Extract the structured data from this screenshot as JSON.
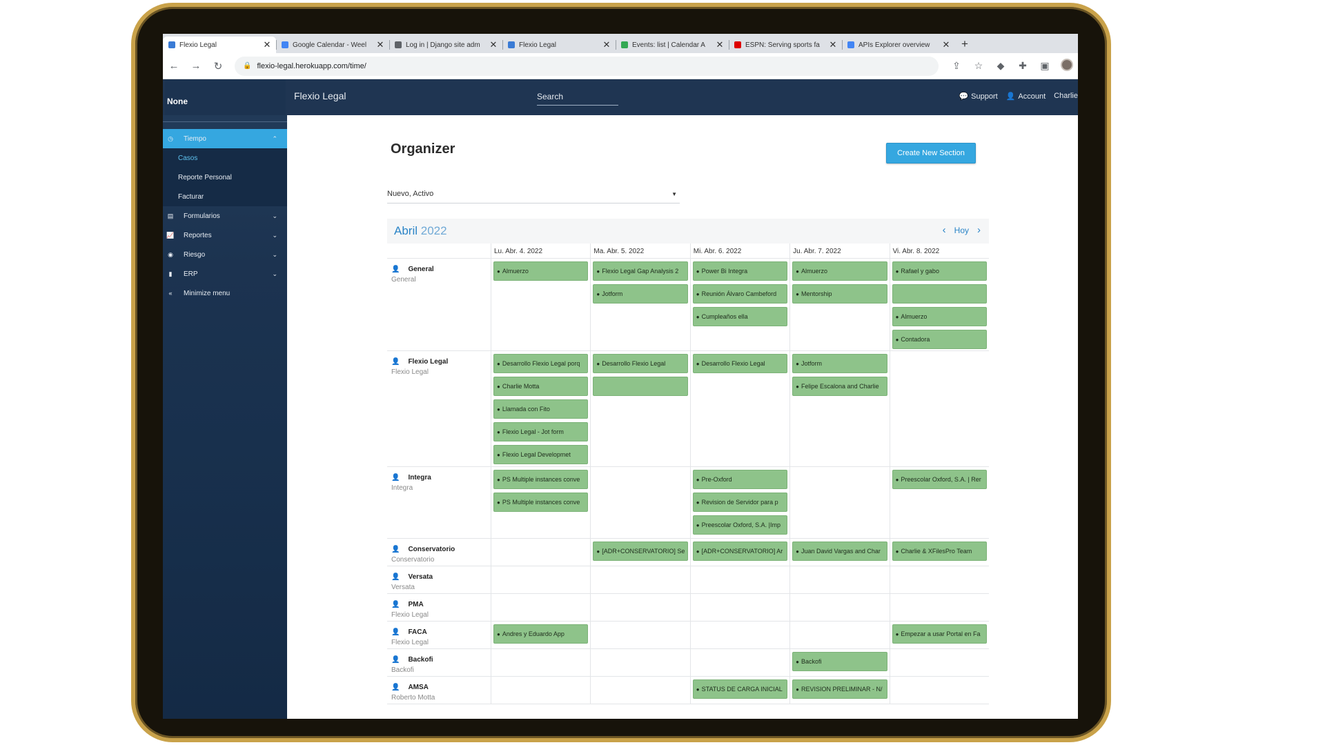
{
  "browser": {
    "tabs": [
      {
        "title": "Flexio Legal",
        "color": "#3a7bd5",
        "active": true
      },
      {
        "title": "Google Calendar - Weel",
        "color": "#4285f4",
        "active": false
      },
      {
        "title": "Log in | Django site adm",
        "color": "#5f6368",
        "active": false
      },
      {
        "title": "Flexio Legal",
        "color": "#3a7bd5",
        "active": false
      },
      {
        "title": "Events: list | Calendar A",
        "color": "#34a853",
        "active": false
      },
      {
        "title": "ESPN: Serving sports fa",
        "color": "#d00",
        "active": false
      },
      {
        "title": "APIs Explorer overview",
        "color": "#4285f4",
        "active": false
      }
    ],
    "new_tab": "+",
    "close": "✕",
    "url": "flexio-legal.herokuapp.com/time/"
  },
  "header": {
    "org": "None",
    "brand": "Flexio Legal",
    "search": "Search",
    "support": "Support",
    "account": "Account",
    "user": "Charlie"
  },
  "sidebar": {
    "tiempo": "Tiempo",
    "sub": [
      "Casos",
      "Reporte Personal",
      "Facturar"
    ],
    "items": [
      "Formularios",
      "Reportes",
      "Riesgo",
      "ERP"
    ],
    "minimize": "Minimize menu"
  },
  "main": {
    "title": "Organizer",
    "create_button": "Create New Section",
    "filter_value": "Nuevo, Activo",
    "month": "Abril",
    "year": "2022",
    "today": "Hoy"
  },
  "calendar": {
    "days": [
      "Lu. Abr. 4. 2022",
      "Ma. Abr. 5. 2022",
      "Mi. Abr. 6. 2022",
      "Ju. Abr. 7. 2022",
      "Vi. Abr. 8. 2022"
    ],
    "rows": [
      {
        "name": "General",
        "sub": "General",
        "height": 134,
        "cells": [
          [
            "Almuerzo"
          ],
          [
            "Flexio Legal Gap Analysis 2",
            "Jotform"
          ],
          [
            "Power Bi Integra",
            "Reunión Álvaro Cambeford",
            "Cumpleaños ella"
          ],
          [
            "Almuerzo",
            "Mentorship"
          ],
          [
            "Rafael y gabo",
            "",
            "Almuerzo",
            "Contadora"
          ]
        ]
      },
      {
        "name": "Flexio Legal",
        "sub": "Flexio Legal",
        "height": 168,
        "cells": [
          [
            "Desarrollo Flexio Legal porq",
            "Charlie Motta",
            "Llamada con Fito",
            "Flexio Legal - Jot form",
            "Flexio Legal Developmet"
          ],
          [
            "Desarrollo Flexio Legal",
            ""
          ],
          [
            "Desarrollo Flexio Legal"
          ],
          [
            "Jotform",
            "Felipe Escalona and Charlie"
          ],
          []
        ]
      },
      {
        "name": "Integra",
        "sub": "Integra",
        "height": 104,
        "cells": [
          [
            "PS Multiple instances conve",
            "PS Multiple instances conve"
          ],
          [],
          [
            "Pre-Oxford",
            "Revision de Servidor para p",
            "Preescolar Oxford, S.A. |Imp"
          ],
          [],
          [
            "Preescolar Oxford, S.A. | Rer"
          ]
        ]
      },
      {
        "name": "Conservatorio",
        "sub": "Conservatorio",
        "height": 40,
        "cells": [
          [],
          [
            "[ADR+CONSERVATORIO] Se"
          ],
          [
            "[ADR+CONSERVATORIO] Ar"
          ],
          [
            "Juan David Vargas and Char"
          ],
          [
            "Charlie & XFilesPro Team"
          ]
        ]
      },
      {
        "name": "Versata",
        "sub": "Versata",
        "height": 40,
        "cells": [
          [],
          [],
          [],
          [],
          []
        ]
      },
      {
        "name": "PMA",
        "sub": "Flexio Legal",
        "height": 40,
        "cells": [
          [],
          [],
          [],
          [],
          []
        ]
      },
      {
        "name": "FACA",
        "sub": "Flexio Legal",
        "height": 40,
        "cells": [
          [
            "Andres y Eduardo App"
          ],
          [],
          [],
          [],
          [
            "Empezar a usar Portal en Fa"
          ]
        ]
      },
      {
        "name": "Backofi",
        "sub": "Backofi",
        "height": 40,
        "cells": [
          [],
          [],
          [],
          [
            "Backofi"
          ],
          []
        ]
      },
      {
        "name": "AMSA",
        "sub": "Roberto Motta",
        "height": 40,
        "cells": [
          [],
          [],
          [
            "STATUS DE CARGA INICIAL"
          ],
          [
            "REVISION PRELIMINAR - N/"
          ],
          []
        ]
      }
    ]
  }
}
